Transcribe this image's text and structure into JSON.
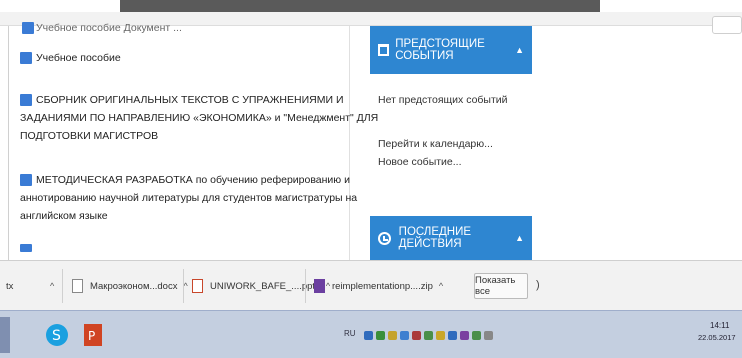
{
  "documents": [
    {
      "label": "Учебное пособие Документ ..."
    },
    {
      "label": "Учебное пособие"
    },
    {
      "label": "СБОРНИК ОРИГИНАЛЬНЫХ ТЕКСТОВ С УПРАЖНЕНИЯМИ И"
    },
    {
      "label": "ЗАДАНИЯМИ ПО НАПРАВЛЕНИЮ «ЭКОНОМИКА» и \"Менеджмент\" ДЛЯ"
    },
    {
      "label": "ПОДГОТОВКИ МАГИСТРОВ"
    },
    {
      "label": "МЕТОДИЧЕСКАЯ РАЗРАБОТКА по обучению реферированию и"
    },
    {
      "label": "аннотированию научной литературы для студентов магистратуры на"
    },
    {
      "label": "английском языке"
    }
  ],
  "events_panel": {
    "title": "ПРЕДСТОЯЩИЕ СОБЫТИЯ",
    "empty_text": "Нет предстоящих событий",
    "calendar_link": "Перейти к календарю...",
    "new_event_link": "Новое событие..."
  },
  "activity_panel": {
    "title": "ПОСЛЕДНИЕ ДЕЙСТВИЯ"
  },
  "downloads": {
    "items": [
      {
        "name": "tx"
      },
      {
        "name": "Макроэконом...docx"
      },
      {
        "name": "UNIWORK_BAFE_....pptx"
      },
      {
        "name": "reimplementationp....zip"
      }
    ],
    "show_all_label": "Показать все",
    "close_symbol": ")"
  },
  "taskbar": {
    "lang": "RU",
    "time": "14:11",
    "date": "22.05.2017"
  },
  "colors": {
    "panel_blue": "#2e86d1",
    "doc_icon_blue": "#3a7bd5"
  }
}
